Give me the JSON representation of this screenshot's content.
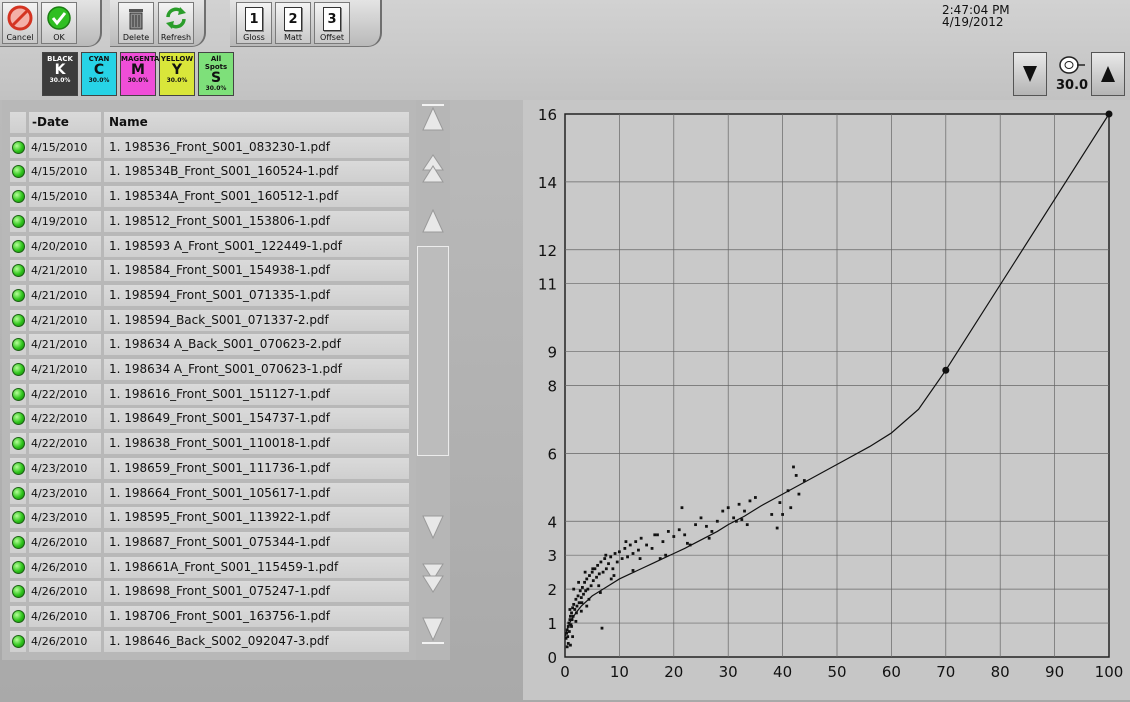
{
  "toolbar": {
    "cancel_label": "Cancel",
    "ok_label": "OK",
    "delete_label": "Delete",
    "refresh_label": "Refresh",
    "gloss_label": "Gloss",
    "gloss_num": "1",
    "matt_label": "Matt",
    "matt_num": "2",
    "offset_label": "Offset",
    "offset_num": "3"
  },
  "inks": [
    {
      "name": "BLACK",
      "letter": "K",
      "percent": "30.0%",
      "color": "#3c3c3c"
    },
    {
      "name": "CYAN",
      "letter": "C",
      "percent": "30.0%",
      "color": "#27d3e6"
    },
    {
      "name": "MAGENTA",
      "letter": "M",
      "percent": "30.0%",
      "color": "#f04ed8"
    },
    {
      "name": "YELLOW",
      "letter": "Y",
      "percent": "30.0%",
      "color": "#d9e63a"
    },
    {
      "name": "All Spots",
      "letter": "S",
      "percent": "30.0%",
      "color": "#7ee07a"
    }
  ],
  "clock": {
    "time": "2:47:04 PM",
    "date": "4/19/2012"
  },
  "gauge": {
    "value": "30.0",
    "icon": "stopwatch-icon"
  },
  "table": {
    "columns": [
      "-Date",
      "Name"
    ],
    "rows": [
      {
        "date": "4/15/2010",
        "name": "1. 198536_Front_S001_083230-1.pdf"
      },
      {
        "date": "4/15/2010",
        "name": "1. 198534B_Front_S001_160524-1.pdf"
      },
      {
        "date": "4/15/2010",
        "name": "1. 198534A_Front_S001_160512-1.pdf"
      },
      {
        "date": "4/19/2010",
        "name": "1. 198512_Front_S001_153806-1.pdf"
      },
      {
        "date": "4/20/2010",
        "name": "1. 198593 A_Front_S001_122449-1.pdf"
      },
      {
        "date": "4/21/2010",
        "name": "1. 198584_Front_S001_154938-1.pdf"
      },
      {
        "date": "4/21/2010",
        "name": "1. 198594_Front_S001_071335-1.pdf"
      },
      {
        "date": "4/21/2010",
        "name": "1. 198594_Back_S001_071337-2.pdf"
      },
      {
        "date": "4/21/2010",
        "name": "1. 198634 A_Back_S001_070623-2.pdf"
      },
      {
        "date": "4/21/2010",
        "name": "1. 198634 A_Front_S001_070623-1.pdf"
      },
      {
        "date": "4/22/2010",
        "name": "1. 198616_Front_S001_151127-1.pdf"
      },
      {
        "date": "4/22/2010",
        "name": "1. 198649_Front_S001_154737-1.pdf"
      },
      {
        "date": "4/22/2010",
        "name": "1. 198638_Front_S001_110018-1.pdf"
      },
      {
        "date": "4/23/2010",
        "name": "1. 198659_Front_S001_111736-1.pdf"
      },
      {
        "date": "4/23/2010",
        "name": "1. 198664_Front_S001_105617-1.pdf"
      },
      {
        "date": "4/23/2010",
        "name": "1. 198595_Front_S001_113922-1.pdf"
      },
      {
        "date": "4/26/2010",
        "name": "1. 198687_Front_S001_075344-1.pdf"
      },
      {
        "date": "4/26/2010",
        "name": "1. 198661A_Front_S001_115459-1.pdf"
      },
      {
        "date": "4/26/2010",
        "name": "1. 198698_Front_S001_075247-1.pdf"
      },
      {
        "date": "4/26/2010",
        "name": "1. 198706_Front_S001_163756-1.pdf"
      },
      {
        "date": "4/26/2010",
        "name": "1. 198646_Back_S002_092047-3.pdf"
      }
    ],
    "status_color": "#2fc41c"
  },
  "chart_data": {
    "type": "line",
    "xlim": [
      0,
      100
    ],
    "ylim": [
      0,
      16
    ],
    "xticks": [
      0,
      10,
      20,
      30,
      40,
      50,
      60,
      70,
      80,
      90,
      100
    ],
    "yticks": [
      0,
      1,
      2,
      3,
      4,
      6,
      8,
      9,
      11,
      12,
      14,
      16
    ],
    "grid": true,
    "curve": {
      "x": [
        0,
        0.5,
        1,
        2,
        3,
        4,
        5,
        6,
        8,
        10,
        12,
        14,
        16,
        18,
        20,
        22,
        25,
        28,
        30,
        33,
        36,
        40,
        44,
        48,
        52,
        56,
        60,
        65,
        70,
        100
      ],
      "y": [
        0.6,
        0.85,
        1.05,
        1.3,
        1.5,
        1.65,
        1.8,
        1.9,
        2.1,
        2.3,
        2.45,
        2.6,
        2.75,
        2.9,
        3.05,
        3.2,
        3.45,
        3.7,
        3.9,
        4.15,
        4.45,
        4.8,
        5.15,
        5.5,
        5.85,
        6.2,
        6.6,
        7.3,
        8.45,
        16.0
      ],
      "control_points": {
        "x": [
          70,
          100
        ],
        "y": [
          8.45,
          16.0
        ]
      }
    },
    "scatter": {
      "x": [
        0.2,
        0.3,
        0.4,
        0.5,
        0.6,
        0.7,
        0.8,
        0.9,
        1.0,
        1.1,
        1.2,
        1.3,
        1.4,
        1.5,
        1.6,
        1.8,
        2.0,
        2.2,
        2.4,
        2.6,
        2.8,
        3.0,
        3.2,
        3.4,
        3.6,
        3.8,
        4.0,
        4.2,
        4.5,
        4.8,
        5.0,
        5.2,
        5.5,
        5.8,
        6.0,
        6.3,
        6.6,
        7.0,
        7.3,
        7.6,
        8.0,
        8.4,
        8.8,
        9.2,
        9.6,
        10.0,
        10.5,
        11.0,
        11.5,
        12.0,
        12.5,
        13.0,
        13.5,
        14.0,
        15.0,
        16.0,
        17.0,
        18.0,
        19.0,
        20.0,
        21.0,
        22.0,
        24.0,
        25.0,
        26.0,
        28.0,
        29.0,
        30.0,
        31.0,
        32.0,
        33.0,
        33.5,
        34.0,
        39.0,
        40.0,
        41.0,
        42.0,
        43.0,
        44.0,
        0.4,
        0.6,
        0.9,
        1.2,
        1.6,
        2.1,
        2.5,
        3.1,
        3.7,
        4.4,
        5.1,
        6.2,
        7.5,
        9.0,
        11.2,
        13.8,
        16.5,
        18.5,
        21.5,
        23.0,
        27.0,
        31.5,
        35.0,
        38.0,
        41.5,
        1.0,
        1.4,
        2.0,
        3.0,
        4.0,
        6.5,
        8.5,
        12.5,
        17.5,
        22.5,
        26.5,
        32.5,
        39.5,
        42.5,
        6.8
      ],
      "y": [
        0.55,
        0.7,
        0.8,
        0.6,
        0.9,
        1.0,
        0.75,
        1.1,
        1.2,
        0.95,
        1.3,
        1.1,
        1.45,
        1.2,
        1.55,
        1.4,
        1.7,
        1.5,
        1.8,
        1.6,
        1.95,
        1.75,
        2.05,
        1.85,
        2.2,
        1.95,
        2.3,
        2.0,
        2.4,
        2.1,
        2.5,
        2.25,
        2.6,
        2.35,
        2.7,
        2.45,
        2.8,
        2.5,
        2.9,
        2.6,
        2.75,
        2.95,
        2.6,
        3.05,
        2.8,
        3.1,
        2.9,
        3.2,
        2.95,
        3.3,
        3.05,
        3.4,
        3.15,
        3.5,
        3.3,
        3.2,
        3.6,
        3.4,
        3.7,
        3.55,
        3.75,
        3.6,
        3.9,
        4.1,
        3.85,
        4.0,
        4.3,
        4.4,
        4.1,
        4.5,
        4.3,
        3.9,
        4.6,
        3.8,
        4.2,
        4.9,
        5.6,
        4.8,
        5.2,
        0.3,
        0.4,
        1.4,
        0.9,
        2.0,
        1.3,
        2.2,
        1.6,
        2.5,
        1.7,
        2.6,
        2.1,
        3.0,
        2.4,
        3.4,
        2.9,
        3.6,
        3.0,
        4.4,
        3.3,
        3.7,
        4.0,
        4.7,
        4.2,
        4.4,
        0.35,
        0.6,
        1.05,
        1.35,
        1.5,
        1.9,
        2.3,
        2.55,
        2.9,
        3.35,
        3.5,
        4.05,
        4.55,
        5.35,
        0.85
      ]
    }
  }
}
